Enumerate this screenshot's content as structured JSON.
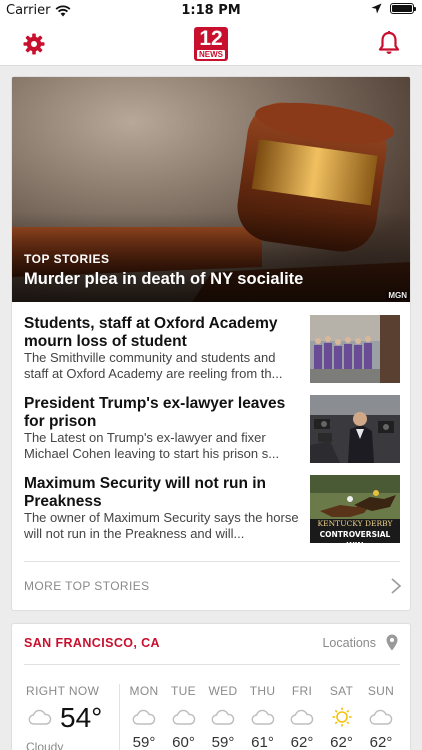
{
  "status": {
    "carrier": "Carrier",
    "time": "1:18 PM"
  },
  "nav": {
    "logo_number": "12",
    "logo_word": "NEWS"
  },
  "hero": {
    "kicker": "TOP STORIES",
    "title": "Murder plea in death of NY socialite",
    "credit": "MGN"
  },
  "stories": [
    {
      "title": "Students, staff at Oxford Academy mourn loss of student",
      "summary": "The Smithville community and students and staff at Oxford Academy are reeling from th..."
    },
    {
      "title": "President Trump's ex-lawyer leaves for prison",
      "summary": "The Latest on Trump's ex-lawyer and fixer Michael Cohen leaving to start his prison s..."
    },
    {
      "title": "Maximum Security will not run in Preakness",
      "summary": "The owner of Maximum Security says the horse will not run in the Preakness and will...",
      "thumb_line1": "KENTUCKY DERBY",
      "thumb_line2": "CONTROVERSIAL WIN"
    }
  ],
  "more": {
    "label": "MORE TOP STORIES"
  },
  "weather": {
    "location": "SAN FRANCISCO, CA",
    "locations_link": "Locations",
    "now_label": "RIGHT NOW",
    "now_temp": "54°",
    "now_condition": "Cloudy",
    "days": [
      {
        "name": "MON",
        "icon": "cloud-icon",
        "temp": "59°"
      },
      {
        "name": "TUE",
        "icon": "cloud-icon",
        "temp": "60°"
      },
      {
        "name": "WED",
        "icon": "cloud-icon",
        "temp": "59°"
      },
      {
        "name": "THU",
        "icon": "cloud-icon",
        "temp": "61°"
      },
      {
        "name": "FRI",
        "icon": "cloud-icon",
        "temp": "62°"
      },
      {
        "name": "SAT",
        "icon": "sun-icon",
        "temp": "62°"
      },
      {
        "name": "SUN",
        "icon": "cloud-icon",
        "temp": "62°"
      }
    ]
  },
  "colors": {
    "brand": "#c8102e",
    "sun": "#f4c20d",
    "muted": "#8a8a8a"
  }
}
